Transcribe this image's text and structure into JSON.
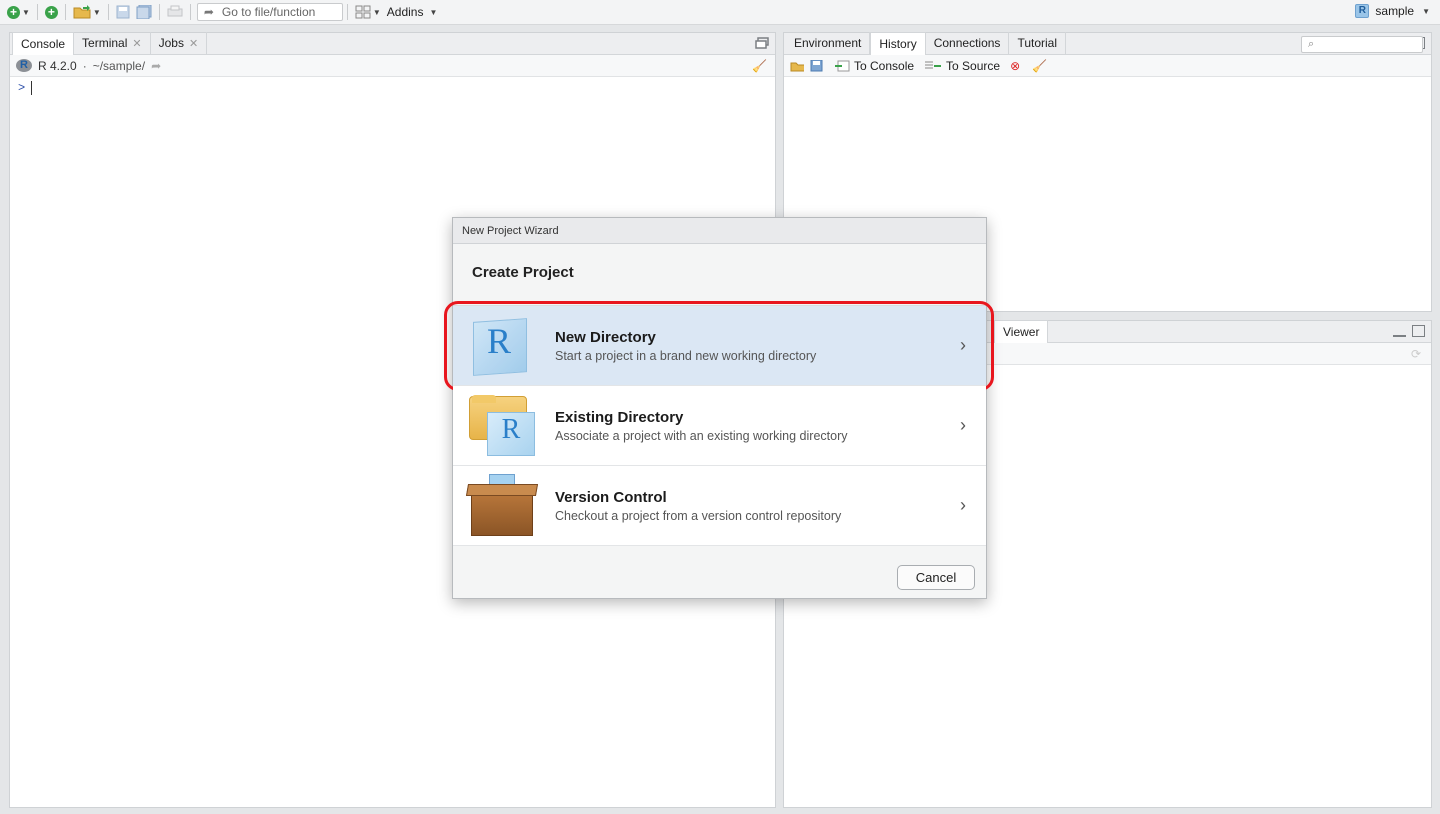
{
  "toolbar": {
    "goto_placeholder": "Go to file/function",
    "addins_label": "Addins",
    "user_label": "sample"
  },
  "left_pane": {
    "tabs": [
      {
        "label": "Console",
        "active": true
      },
      {
        "label": "Terminal",
        "closable": true
      },
      {
        "label": "Jobs",
        "closable": true
      }
    ],
    "r_version": "R 4.2.0",
    "separator": "·",
    "working_dir": "~/sample/",
    "prompt": ">"
  },
  "right_top_pane": {
    "tabs": [
      {
        "label": "Environment"
      },
      {
        "label": "History",
        "active": true
      },
      {
        "label": "Connections"
      },
      {
        "label": "Tutorial"
      }
    ],
    "to_console_label": "To Console",
    "to_source_label": "To Source"
  },
  "right_bottom_pane": {
    "tabs": [
      {
        "label": "Viewer",
        "active": true
      }
    ]
  },
  "dialog": {
    "window_title": "New Project Wizard",
    "heading": "Create Project",
    "options": [
      {
        "title": "New Directory",
        "description": "Start a project in a brand new working directory",
        "icon": "r-cube-icon",
        "selected": true
      },
      {
        "title": "Existing Directory",
        "description": "Associate a project with an existing working directory",
        "icon": "folder-r-icon"
      },
      {
        "title": "Version Control",
        "description": "Checkout a project from a version control repository",
        "icon": "box-icon"
      }
    ],
    "cancel_label": "Cancel"
  },
  "colors": {
    "highlight_outline": "#e8161e",
    "selected_row": "#dbe7f4",
    "accent_blue": "#2a7fc9"
  }
}
